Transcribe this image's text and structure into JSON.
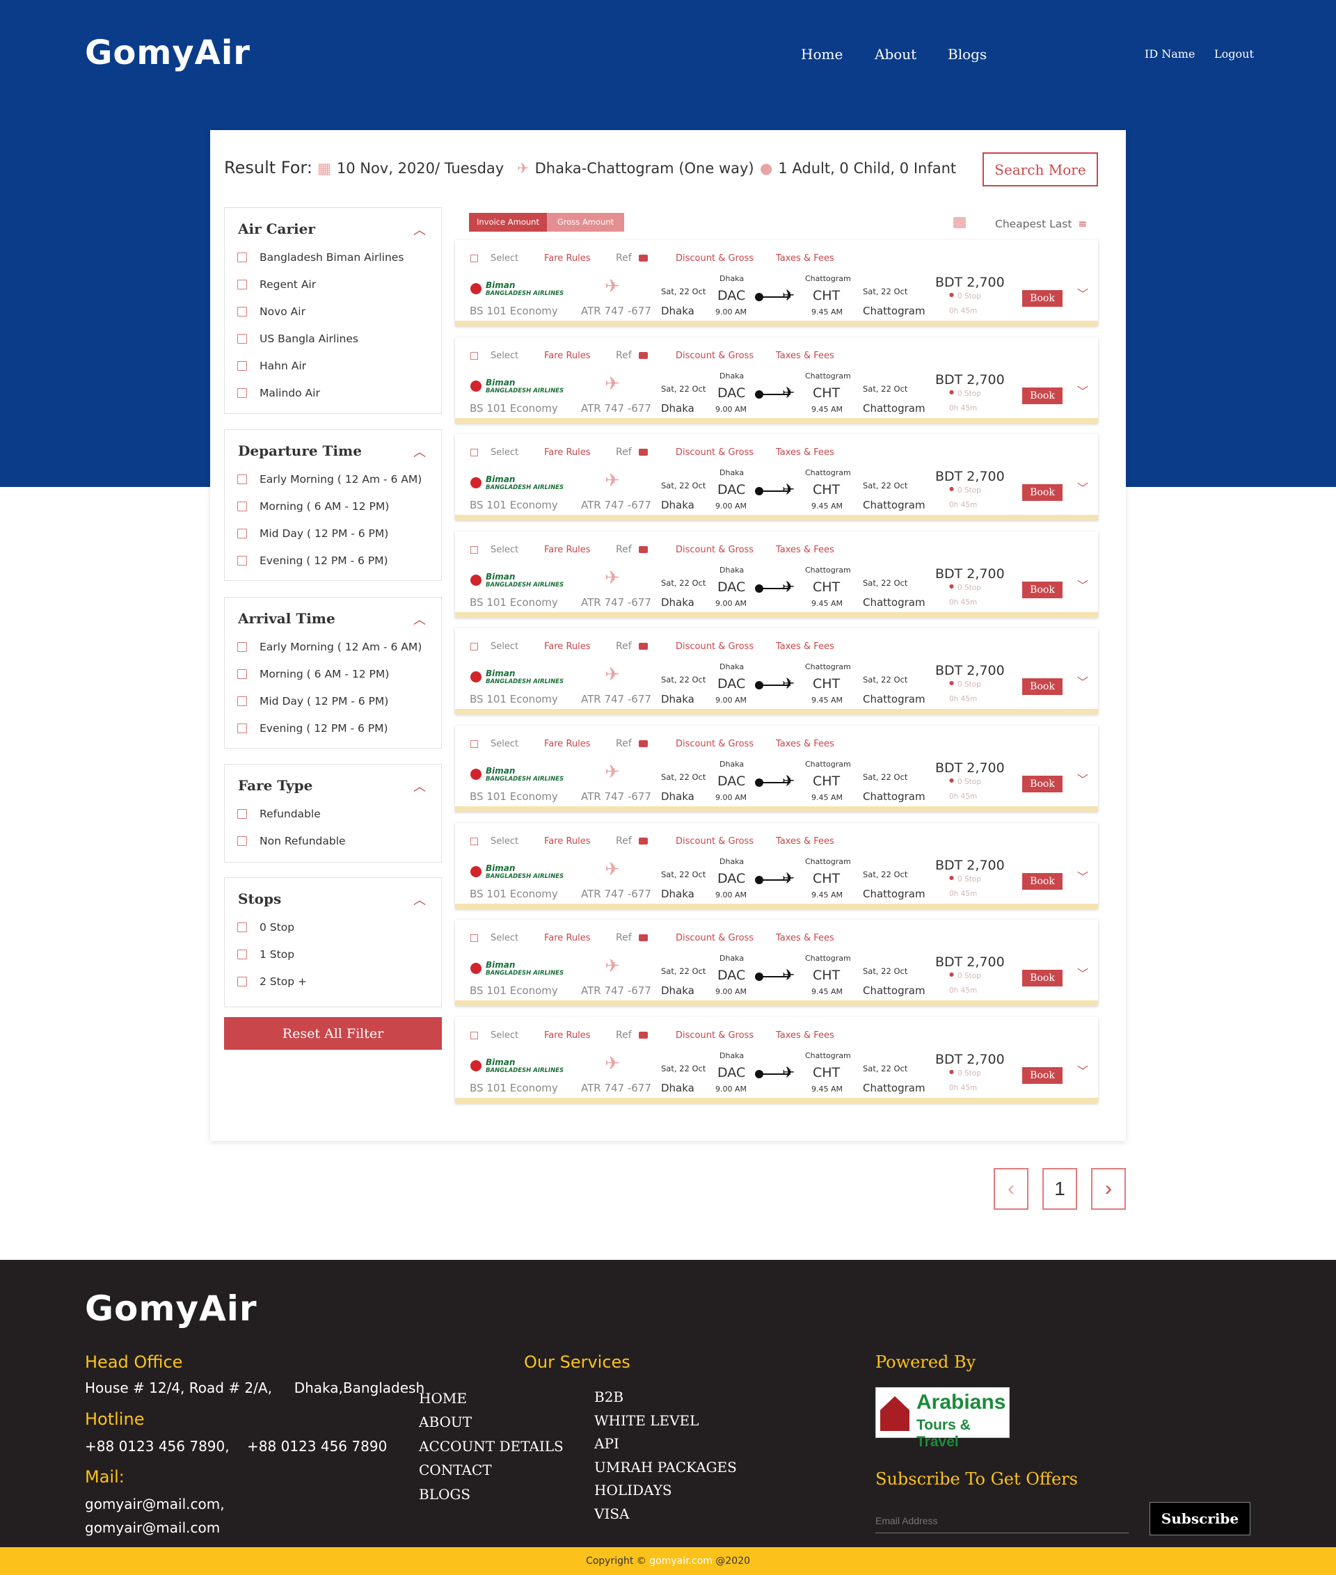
{
  "brand": {
    "name": "GomyAir"
  },
  "nav": {
    "home": "Home",
    "about": "About",
    "blogs": "Blogs",
    "id_name": "ID Name",
    "logout": "Logout"
  },
  "result": {
    "label": "Result For:",
    "date": "10 Nov, 2020/ Tuesday",
    "route": "Dhaka-Chattogram (One way)",
    "passengers": "1 Adult, 0 Child, 0 Infant",
    "search_more": "Search More"
  },
  "filters": [
    {
      "title": "Air Carier",
      "items": [
        "Bangladesh Biman Airlines",
        "Regent Air",
        "Novo Air",
        "US Bangla Airlines",
        "Hahn Air",
        "Malindo Air"
      ]
    },
    {
      "title": "Departure Time",
      "items": [
        "Early Morning ( 12 Am - 6 AM)",
        "Morning ( 6 AM - 12 PM)",
        "Mid Day ( 12 PM - 6 PM)",
        "Evening ( 12 PM - 6 PM)"
      ]
    },
    {
      "title": "Arrival Time",
      "items": [
        "Early Morning ( 12 Am - 6 AM)",
        "Morning ( 6 AM - 12 PM)",
        "Mid Day ( 12 PM - 6 PM)",
        "Evening ( 12 PM - 6 PM)"
      ]
    },
    {
      "title": "Fare Type",
      "items": [
        "Refundable",
        "Non Refundable"
      ]
    },
    {
      "title": "Stops",
      "items": [
        "0 Stop",
        "1 Stop",
        "2 Stop +"
      ]
    }
  ],
  "reset_label": "Reset All Filter",
  "toolbar": {
    "invoice": "Invoice Amount",
    "gross": "Gross Amount",
    "sort": "Cheapest Last"
  },
  "flight_labels": {
    "select": "Select",
    "fare_rules": "Fare Rules",
    "ref": "Ref",
    "discount": "Discount & Gross",
    "taxes": "Taxes & Fees",
    "airline_top": "Biman",
    "airline_bottom": "BANGLADESH AIRLINES",
    "book": "Book"
  },
  "flights": [
    {
      "code": "BS 101 Economy",
      "aircraft": "ATR 747 -677",
      "dep_date": "Sat, 22 Oct",
      "dep_city": "Dhaka",
      "dep_label": "Dhaka",
      "dep_code": "DAC",
      "dep_time": "9.00 AM",
      "arr_label": "Chattogram",
      "arr_code": "CHT",
      "arr_time": "9.45 AM",
      "arr_date": "Sat, 22 Oct",
      "arr_city": "Chattogram",
      "price": "BDT 2,700",
      "stops": "0 Stop",
      "duration": "0h 45m"
    },
    {
      "code": "BS 101 Economy",
      "aircraft": "ATR 747 -677",
      "dep_date": "Sat, 22 Oct",
      "dep_city": "Dhaka",
      "dep_label": "Dhaka",
      "dep_code": "DAC",
      "dep_time": "9.00 AM",
      "arr_label": "Chattogram",
      "arr_code": "CHT",
      "arr_time": "9.45 AM",
      "arr_date": "Sat, 22 Oct",
      "arr_city": "Chattogram",
      "price": "BDT 2,700",
      "stops": "0 Stop",
      "duration": "0h 45m"
    },
    {
      "code": "BS 101 Economy",
      "aircraft": "ATR 747 -677",
      "dep_date": "Sat, 22 Oct",
      "dep_city": "Dhaka",
      "dep_label": "Dhaka",
      "dep_code": "DAC",
      "dep_time": "9.00 AM",
      "arr_label": "Chattogram",
      "arr_code": "CHT",
      "arr_time": "9.45 AM",
      "arr_date": "Sat, 22 Oct",
      "arr_city": "Chattogram",
      "price": "BDT 2,700",
      "stops": "0 Stop",
      "duration": "0h 45m"
    },
    {
      "code": "BS 101 Economy",
      "aircraft": "ATR 747 -677",
      "dep_date": "Sat, 22 Oct",
      "dep_city": "Dhaka",
      "dep_label": "Dhaka",
      "dep_code": "DAC",
      "dep_time": "9.00 AM",
      "arr_label": "Chattogram",
      "arr_code": "CHT",
      "arr_time": "9.45 AM",
      "arr_date": "Sat, 22 Oct",
      "arr_city": "Chattogram",
      "price": "BDT 2,700",
      "stops": "0 Stop",
      "duration": "0h 45m"
    },
    {
      "code": "BS 101 Economy",
      "aircraft": "ATR 747 -677",
      "dep_date": "Sat, 22 Oct",
      "dep_city": "Dhaka",
      "dep_label": "Dhaka",
      "dep_code": "DAC",
      "dep_time": "9.00 AM",
      "arr_label": "Chattogram",
      "arr_code": "CHT",
      "arr_time": "9.45 AM",
      "arr_date": "Sat, 22 Oct",
      "arr_city": "Chattogram",
      "price": "BDT 2,700",
      "stops": "0 Stop",
      "duration": "0h 45m"
    },
    {
      "code": "BS 101 Economy",
      "aircraft": "ATR 747 -677",
      "dep_date": "Sat, 22 Oct",
      "dep_city": "Dhaka",
      "dep_label": "Dhaka",
      "dep_code": "DAC",
      "dep_time": "9.00 AM",
      "arr_label": "Chattogram",
      "arr_code": "CHT",
      "arr_time": "9.45 AM",
      "arr_date": "Sat, 22 Oct",
      "arr_city": "Chattogram",
      "price": "BDT 2,700",
      "stops": "0 Stop",
      "duration": "0h 45m"
    },
    {
      "code": "BS 101 Economy",
      "aircraft": "ATR 747 -677",
      "dep_date": "Sat, 22 Oct",
      "dep_city": "Dhaka",
      "dep_label": "Dhaka",
      "dep_code": "DAC",
      "dep_time": "9.00 AM",
      "arr_label": "Chattogram",
      "arr_code": "CHT",
      "arr_time": "9.45 AM",
      "arr_date": "Sat, 22 Oct",
      "arr_city": "Chattogram",
      "price": "BDT 2,700",
      "stops": "0 Stop",
      "duration": "0h 45m"
    },
    {
      "code": "BS 101 Economy",
      "aircraft": "ATR 747 -677",
      "dep_date": "Sat, 22 Oct",
      "dep_city": "Dhaka",
      "dep_label": "Dhaka",
      "dep_code": "DAC",
      "dep_time": "9.00 AM",
      "arr_label": "Chattogram",
      "arr_code": "CHT",
      "arr_time": "9.45 AM",
      "arr_date": "Sat, 22 Oct",
      "arr_city": "Chattogram",
      "price": "BDT 2,700",
      "stops": "0 Stop",
      "duration": "0h 45m"
    },
    {
      "code": "BS 101 Economy",
      "aircraft": "ATR 747 -677",
      "dep_date": "Sat, 22 Oct",
      "dep_city": "Dhaka",
      "dep_label": "Dhaka",
      "dep_code": "DAC",
      "dep_time": "9.00 AM",
      "arr_label": "Chattogram",
      "arr_code": "CHT",
      "arr_time": "9.45 AM",
      "arr_date": "Sat, 22 Oct",
      "arr_city": "Chattogram",
      "price": "BDT 2,700",
      "stops": "0 Stop",
      "duration": "0h 45m"
    }
  ],
  "pagination": {
    "prev": "‹",
    "page": "1",
    "next": "›"
  },
  "footer": {
    "head_office_title": "Head Office",
    "head_office_address": "House # 12/4, Road # 2/A,     Dhaka,Bangladesh",
    "hotline_title": "Hotline",
    "hotline": "+88 0123 456 7890,    +88 0123 456 7890",
    "mail_title": "Mail:",
    "mail1": "gomyair@mail.com,",
    "mail2": "gomyair@mail.com",
    "services_title": "Our Services",
    "links_left": [
      "HOME",
      "ABOUT",
      "ACCOUNT DETAILS",
      "CONTACT",
      "BLOGS"
    ],
    "links_right": [
      "B2B",
      "WHITE LEVEL",
      "API",
      "UMRAH PACKAGES",
      "HOLIDAYS",
      "VISA"
    ],
    "powered_title": "Powered By",
    "powered_logo_top": "Arabians",
    "powered_logo_bottom": "Tours & Travel",
    "subscribe_title": "Subscribe To Get Offers",
    "email_placeholder": "Email Address",
    "subscribe_btn": "Subscribe",
    "copyright_pre": "Copyright ©",
    "copyright_site": "gomyair.com",
    "copyright_year": "@2020"
  },
  "colors": {
    "primary": "#0b3c89",
    "accent": "#c9464b",
    "yellow": "#fcc21b",
    "footer": "#231f20"
  }
}
